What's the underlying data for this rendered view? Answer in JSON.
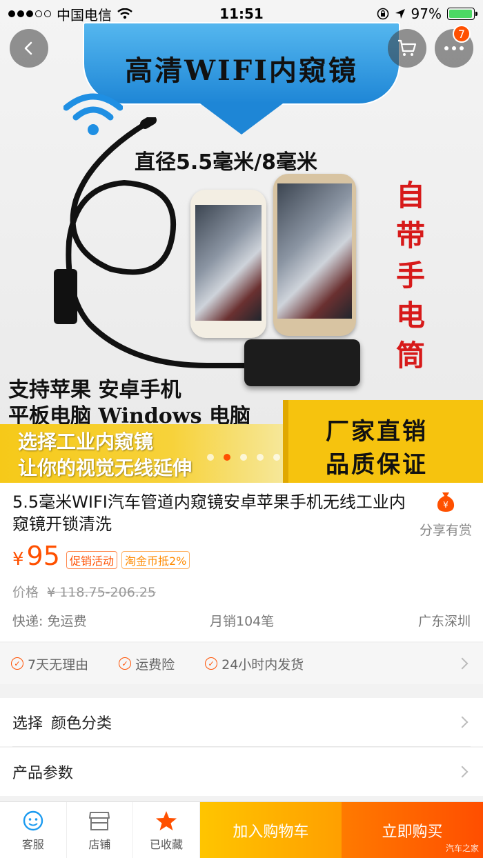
{
  "status_bar": {
    "carrier": "中国电信",
    "time": "11:51",
    "battery": "97%",
    "battery_level": 0.97,
    "signal_bars": 3,
    "signal_total": 5
  },
  "nav": {
    "back_icon": "chevron-left-icon",
    "cart_icon": "cart-icon",
    "more_icon": "more-dots-icon",
    "more_badge": "7"
  },
  "hero": {
    "headline": "高清WIFI内窥镜",
    "diameter": "直径5.5毫米/8毫米",
    "vertical_text": "自带手电筒",
    "support_line1": "支持苹果 安卓手机",
    "support_line2": "平板电脑 Windows 电脑",
    "banner_left_line1": "选择工业内窥镜",
    "banner_left_line2": "让你的视觉无线延伸",
    "banner_right_line1": "厂家直销",
    "banner_right_line2": "品质保证",
    "slides": 5,
    "active_slide": 1
  },
  "product": {
    "title": "5.5毫米WIFI汽车管道内窥镜安卓苹果手机无线工业内窥镜开锁清洗",
    "share_label": "分享有赏",
    "currency": "¥",
    "price": "95",
    "tag_promo": "促销活动",
    "tag_coin": "淘金币抵2%",
    "orig_label": "价格",
    "orig_price": "¥ 118.75-206.25",
    "shipping": "快递: 免运费",
    "monthly_sales": "月销104笔",
    "location": "广东深圳"
  },
  "services": [
    {
      "label": "7天无理由"
    },
    {
      "label": "运费险"
    },
    {
      "label": "24小时内发货"
    }
  ],
  "options": {
    "select_label": "选择",
    "select_value": "颜色分类",
    "params_label": "产品参数"
  },
  "bottom_bar": {
    "service_label": "客服",
    "shop_label": "店铺",
    "favorite_label": "已收藏",
    "add_cart_label": "加入购物车",
    "buy_now_label": "立即购买"
  },
  "watermark": "汽车之家",
  "colors": {
    "accent": "#ff5000",
    "cart_button": "#ffb300",
    "buy_button": "#ff5a00"
  }
}
